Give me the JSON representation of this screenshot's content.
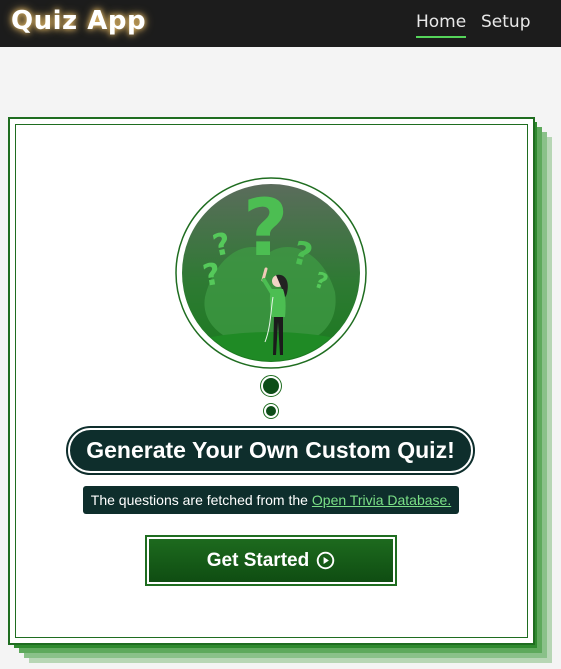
{
  "header": {
    "brand": "Quiz App",
    "nav": [
      {
        "label": "Home",
        "active": true
      },
      {
        "label": "Setup",
        "active": false
      }
    ]
  },
  "hero": {
    "title": "Generate Your Own Custom Quiz!",
    "subtitle_prefix": "The questions are fetched from the",
    "subtitle_link": "Open Trivia Database.",
    "cta_label": "Get Started",
    "cta_icon": "play-circle-icon",
    "illustration": "question-marks-person-illustration"
  },
  "colors": {
    "header_bg": "#1c1c1c",
    "accent_green": "#1f6d20",
    "pill_bg": "#0e2e2c",
    "link_green": "#7be087"
  }
}
